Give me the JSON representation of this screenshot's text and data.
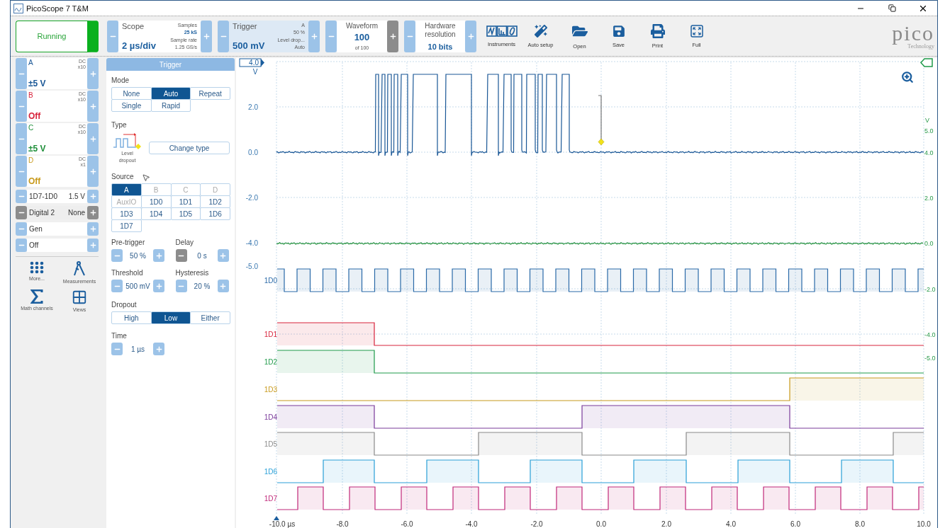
{
  "window": {
    "title": "PicoScope 7 T&M"
  },
  "toolbar": {
    "run": {
      "label": "Running",
      "running": true
    },
    "scope": {
      "title": "Scope",
      "value": "2 µs/div",
      "samples_label": "Samples",
      "samples": "25 kS",
      "rate_label": "Sample rate",
      "rate": "1.25 GS/s"
    },
    "trigger": {
      "title": "Trigger",
      "value": "500 mV",
      "source": "A",
      "level": "50 %",
      "type": "Level drop...",
      "mode": "Auto"
    },
    "waveform": {
      "title": "Waveform",
      "value": "100",
      "of": "of 100",
      "next_disabled": true
    },
    "resolution": {
      "title": "Hardware resolution",
      "value": "10 bits"
    },
    "tools": [
      {
        "label": "Instruments",
        "kind": "instruments"
      },
      {
        "label": "Auto setup",
        "kind": "auto"
      },
      {
        "label": "Open",
        "kind": "open"
      },
      {
        "label": "Save",
        "kind": "save"
      },
      {
        "label": "Print",
        "kind": "print"
      },
      {
        "label": "Full",
        "kind": "full"
      }
    ],
    "logo": {
      "name": "pico",
      "tagline": "Technology"
    }
  },
  "channels": [
    {
      "name": "A",
      "coupling": "DC",
      "probe": "x10",
      "range": "±5 V",
      "color": "#1a5796"
    },
    {
      "name": "B",
      "coupling": "DC",
      "probe": "x10",
      "range": "Off",
      "color": "#d8243c"
    },
    {
      "name": "C",
      "coupling": "DC",
      "probe": "x10",
      "range": "±5 V",
      "color": "#1f8f3a"
    },
    {
      "name": "D",
      "coupling": "DC",
      "probe": "x1",
      "range": "Off",
      "color": "#c89a1c"
    }
  ],
  "digital": [
    {
      "label": "1D7-1D0",
      "value": "1.5 V",
      "disabled": false
    },
    {
      "label": "Digital 2",
      "value": "None",
      "disabled": true
    }
  ],
  "generator": [
    "Gen",
    "Off"
  ],
  "side_tools": [
    {
      "label": "More...",
      "kind": "more"
    },
    {
      "label": "Measurements",
      "kind": "measure"
    },
    {
      "label": "Math channels",
      "kind": "math"
    },
    {
      "label": "Views",
      "kind": "views"
    }
  ],
  "trigger_panel": {
    "title": "Trigger",
    "mode": {
      "label": "Mode",
      "options": [
        {
          "label": "None",
          "selected": false
        },
        {
          "label": "Auto",
          "selected": true
        },
        {
          "label": "Repeat",
          "selected": false
        },
        {
          "label": "Single",
          "selected": false
        },
        {
          "label": "Rapid",
          "selected": false
        }
      ]
    },
    "type": {
      "label": "Type",
      "name": "Level dropout",
      "button": "Change type"
    },
    "source": {
      "label": "Source",
      "options": [
        {
          "label": "A",
          "selected": true,
          "disabled": false
        },
        {
          "label": "B",
          "selected": false,
          "disabled": true
        },
        {
          "label": "C",
          "selected": false,
          "disabled": true
        },
        {
          "label": "D",
          "selected": false,
          "disabled": true
        },
        {
          "label": "AuxIO",
          "selected": false,
          "disabled": true
        },
        {
          "label": "1D0",
          "selected": false,
          "disabled": false
        },
        {
          "label": "1D1",
          "selected": false,
          "disabled": false
        },
        {
          "label": "1D2",
          "selected": false,
          "disabled": false
        },
        {
          "label": "1D3",
          "selected": false,
          "disabled": false
        },
        {
          "label": "1D4",
          "selected": false,
          "disabled": false
        },
        {
          "label": "1D5",
          "selected": false,
          "disabled": false
        },
        {
          "label": "1D6",
          "selected": false,
          "disabled": false
        },
        {
          "label": "1D7",
          "selected": false,
          "disabled": false
        }
      ]
    },
    "spinners": [
      {
        "label": "Pre-trigger",
        "value": "50 %",
        "minus_disabled": false
      },
      {
        "label": "Delay",
        "value": "0 s",
        "minus_disabled": true
      },
      {
        "label": "Threshold",
        "value": "500 mV",
        "minus_disabled": false
      },
      {
        "label": "Hysteresis",
        "value": "20 %",
        "minus_disabled": false
      }
    ],
    "dropout": {
      "label": "Dropout",
      "options": [
        {
          "label": "High",
          "selected": false
        },
        {
          "label": "Low",
          "selected": true
        },
        {
          "label": "Either",
          "selected": false
        }
      ]
    },
    "time": {
      "label": "Time",
      "value": "1 µs",
      "minus_disabled": false
    }
  },
  "plot": {
    "left_axis": {
      "marker": "4.0",
      "unit": "V",
      "ticks": [
        "2.0",
        "0.0",
        "-2.0",
        "-4.0",
        "-5.0"
      ]
    },
    "right_axis": {
      "unit": "V",
      "ticks": [
        "5.0",
        "4.0",
        "2.0",
        "0.0",
        "-2.0",
        "-4.0",
        "-5.0"
      ]
    },
    "x_ticks": [
      "-10.0 µs",
      "-8.0",
      "-6.0",
      "-4.0",
      "-2.0",
      "0.0",
      "2.0",
      "4.0",
      "6.0",
      "8.0",
      "10.0"
    ],
    "digital_channels": [
      {
        "label": "1D0",
        "color": "#2a6aa8"
      },
      {
        "label": "1D1",
        "color": "#d8243c"
      },
      {
        "label": "1D2",
        "color": "#1f9a4a"
      },
      {
        "label": "1D3",
        "color": "#c89a1c"
      },
      {
        "label": "1D4",
        "color": "#7a3a9a"
      },
      {
        "label": "1D5",
        "color": "#8a8a8a"
      },
      {
        "label": "1D6",
        "color": "#2aa0d8"
      },
      {
        "label": "1D7",
        "color": "#c0287a"
      }
    ]
  }
}
